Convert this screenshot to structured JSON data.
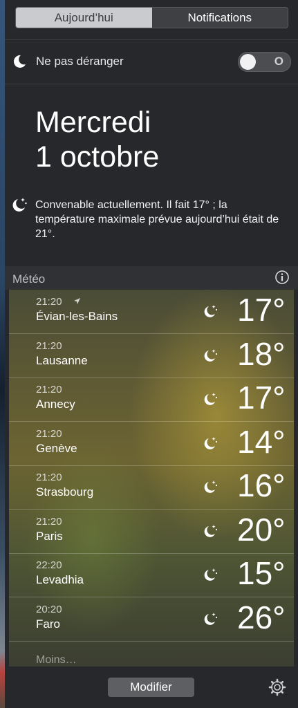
{
  "tabs": {
    "today": "Aujourd’hui",
    "notifications": "Notifications"
  },
  "dnd": {
    "label": "Ne pas déranger",
    "toggle_state": "O",
    "icon": "moon-icon"
  },
  "date": {
    "day": "Mercredi",
    "date": "1 octobre"
  },
  "summary": {
    "icon": "moon-stars-icon",
    "text": "Convenable actuellement. Il fait 17° ; la température maximale prévue aujourd’hui était de 21°."
  },
  "meteo": {
    "title": "Météo",
    "info_icon": "info-icon",
    "rows": [
      {
        "time": "21:20",
        "city": "Évian-les-Bains",
        "temp": "17°",
        "current_location": true
      },
      {
        "time": "21:20",
        "city": "Lausanne",
        "temp": "18°"
      },
      {
        "time": "21:20",
        "city": "Annecy",
        "temp": "17°"
      },
      {
        "time": "21:20",
        "city": "Genève",
        "temp": "14°"
      },
      {
        "time": "21:20",
        "city": "Strasbourg",
        "temp": "16°"
      },
      {
        "time": "21:20",
        "city": "Paris",
        "temp": "20°"
      },
      {
        "time": "22:20",
        "city": "Levadhia",
        "temp": "15°"
      },
      {
        "time": "20:20",
        "city": "Faro",
        "temp": "26°"
      }
    ],
    "moins": "Moins…"
  },
  "footer": {
    "modifier": "Modifier",
    "settings_icon": "gear-icon"
  }
}
